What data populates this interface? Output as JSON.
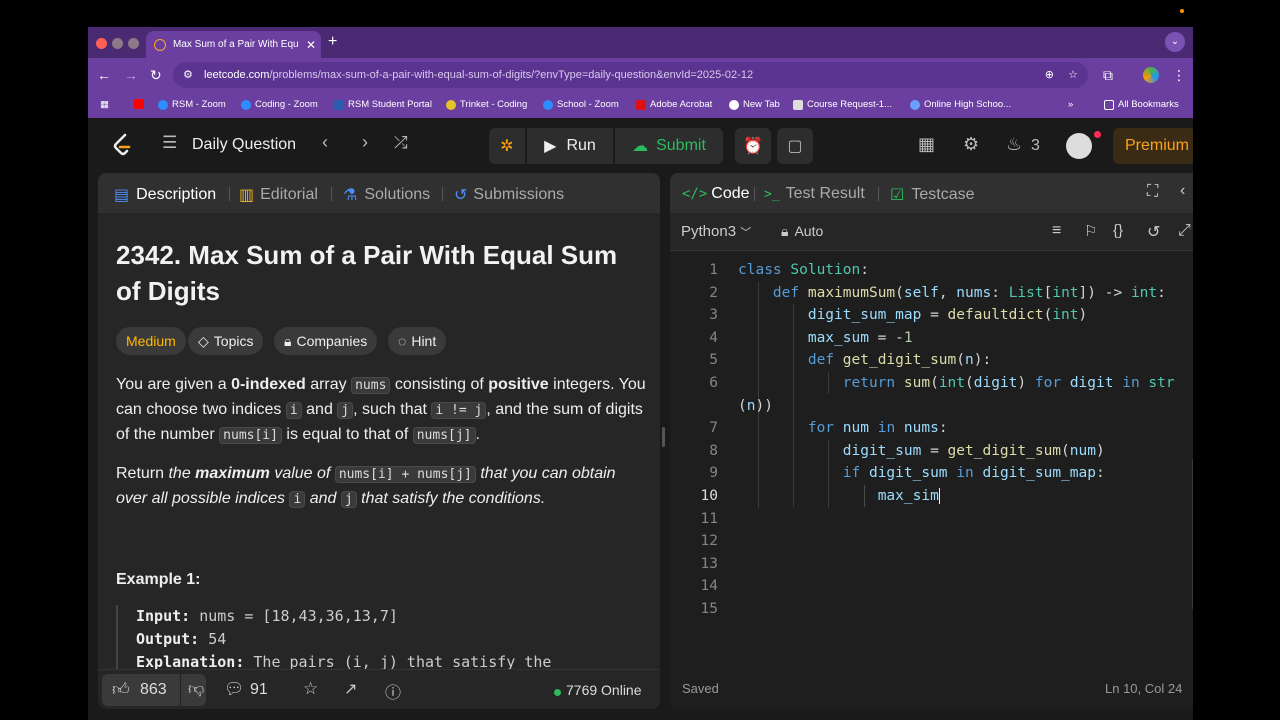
{
  "browser": {
    "tab_title": "Max Sum of a Pair With Equal Sum of Digits - LeetCode",
    "url_host": "leetcode.com",
    "url_path": "/problems/max-sum-of-a-pair-with-equal-sum-of-digits/?envType=daily-question&envId=2025-02-12",
    "bookmarks": [
      "RSM - Zoom",
      "Coding - Zoom",
      "RSM Student Portal",
      "Trinket - Coding",
      "School - Zoom",
      "Adobe Acrobat",
      "New Tab",
      "Course Request-1...",
      "Online High Schoo..."
    ],
    "all_bookmarks": "All Bookmarks"
  },
  "nav": {
    "daily_question": "Daily Question",
    "run": "Run",
    "submit": "Submit",
    "streak": "3",
    "premium": "Premium"
  },
  "left": {
    "tabs": [
      "Description",
      "Editorial",
      "Solutions",
      "Submissions"
    ],
    "title": "2342. Max Sum of a Pair With Equal Sum of Digits",
    "chips": [
      "Medium",
      "Topics",
      "Companies",
      "Hint"
    ],
    "example_heading": "Example 1:",
    "example_input_label": "Input:",
    "example_input": " nums = [18,43,36,13,7]",
    "example_output_label": "Output:",
    "example_output": " 54",
    "example_expl_label": "Explanation:",
    "example_expl": " The pairs (i, j) that satisfy the",
    "likes": "863",
    "comments": "91",
    "online": "7769 Online"
  },
  "right": {
    "tabs": [
      "Code",
      "Test Result",
      "Testcase"
    ],
    "language": "Python3",
    "autosave": "Auto",
    "saved": "Saved",
    "cursor": "Ln 10, Col 24"
  },
  "colors": {
    "accent": "#ffa116",
    "medium": "#ffb800",
    "submit": "#2cbb5d",
    "code_tab_icon": "#ffa116"
  }
}
